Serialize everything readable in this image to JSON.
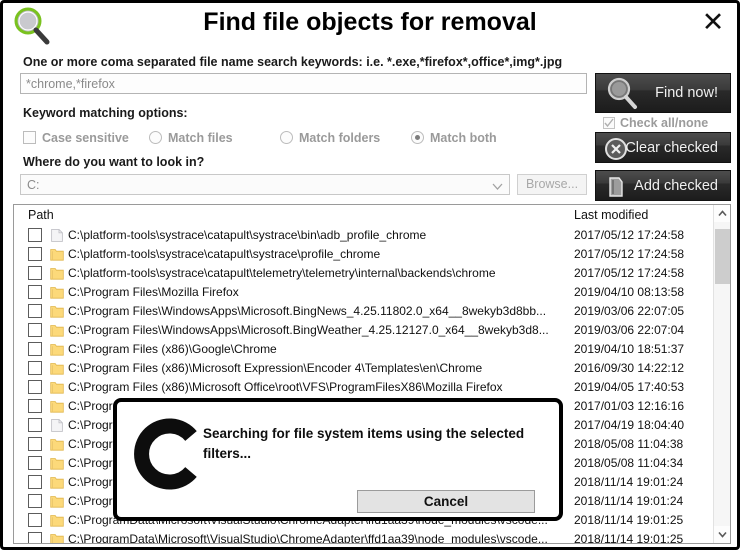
{
  "window": {
    "title": "Find file objects for removal",
    "icon": "magnifier-icon",
    "close_label": "✕"
  },
  "form": {
    "keywords_hint": "One or more coma separated file name search keywords: i.e. *.exe,*firefox*,office*,img*.jpg",
    "keywords_value": "*chrome,*firefox",
    "keywords_placeholder": "*chrome,*firefox",
    "matching_label": "Keyword matching options:",
    "options": [
      {
        "label": "Case sensitive",
        "type": "checkbox",
        "checked": false
      },
      {
        "label": "Match files",
        "type": "radio",
        "checked": false
      },
      {
        "label": "Match folders",
        "type": "radio",
        "checked": false
      },
      {
        "label": "Match both",
        "type": "radio",
        "checked": true
      }
    ],
    "where_label": "Where do you want to look in?",
    "path_value": "C:",
    "browse_label": "Browse..."
  },
  "actions": {
    "find_label": "Find now!",
    "check_all_label": "Check all/none",
    "clear_label": "Clear checked",
    "add_label": "Add checked"
  },
  "list": {
    "columns": {
      "path": "Path",
      "modified": "Last modified"
    },
    "rows": [
      {
        "icon": "file-icon",
        "path": "C:\\platform-tools\\systrace\\catapult\\systrace\\bin\\adb_profile_chrome",
        "modified": "2017/05/12 17:24:58",
        "checked": false
      },
      {
        "icon": "folder-icon",
        "path": "C:\\platform-tools\\systrace\\catapult\\systrace\\profile_chrome",
        "modified": "2017/05/12 17:24:58",
        "checked": false
      },
      {
        "icon": "folder-icon",
        "path": "C:\\platform-tools\\systrace\\catapult\\telemetry\\telemetry\\internal\\backends\\chrome",
        "modified": "2017/05/12 17:24:58",
        "checked": false
      },
      {
        "icon": "folder-icon",
        "path": "C:\\Program Files\\Mozilla Firefox",
        "modified": "2019/04/10 08:13:58",
        "checked": false
      },
      {
        "icon": "folder-icon",
        "path": "C:\\Program Files\\WindowsApps\\Microsoft.BingNews_4.25.11802.0_x64__8wekyb3d8bb...",
        "modified": "2019/03/06 22:07:05",
        "checked": false
      },
      {
        "icon": "folder-icon",
        "path": "C:\\Program Files\\WindowsApps\\Microsoft.BingWeather_4.25.12127.0_x64__8wekyb3d8...",
        "modified": "2019/03/06 22:07:04",
        "checked": false
      },
      {
        "icon": "folder-icon",
        "path": "C:\\Program Files (x86)\\Google\\Chrome",
        "modified": "2019/04/10 18:51:37",
        "checked": false
      },
      {
        "icon": "folder-icon",
        "path": "C:\\Program Files (x86)\\Microsoft Expression\\Encoder 4\\Templates\\en\\Chrome",
        "modified": "2016/09/30 14:22:12",
        "checked": false
      },
      {
        "icon": "folder-icon",
        "path": "C:\\Program Files (x86)\\Microsoft Office\\root\\VFS\\ProgramFilesX86\\Mozilla Firefox",
        "modified": "2019/04/05 17:40:53",
        "checked": false
      },
      {
        "icon": "folder-icon",
        "path": "C:\\Program...",
        "modified": "2017/01/03 12:16:16",
        "checked": false
      },
      {
        "icon": "file-icon",
        "path": "C:\\Program...",
        "modified": "2017/04/19 18:04:40",
        "checked": false
      },
      {
        "icon": "folder-icon",
        "path": "C:\\Program...",
        "modified": "2018/05/08 11:04:38",
        "checked": false
      },
      {
        "icon": "folder-icon",
        "path": "C:\\Program...",
        "modified": "2018/05/08 11:04:34",
        "checked": false
      },
      {
        "icon": "folder-icon",
        "path": "C:\\Program...",
        "modified": "2018/11/14 19:01:24",
        "checked": false
      },
      {
        "icon": "folder-icon",
        "path": "C:\\Program...",
        "modified": "2018/11/14 19:01:24",
        "checked": false
      },
      {
        "icon": "folder-icon",
        "path": "C:\\ProgramData\\Microsoft\\VisualStudio\\ChromeAdapter\\ffd1aa39\\node_modules\\vscode...",
        "modified": "2018/11/14 19:01:25",
        "checked": false
      },
      {
        "icon": "folder-icon",
        "path": "C:\\ProgramData\\Microsoft\\VisualStudio\\ChromeAdapter\\ffd1aa39\\node_modules\\vscode...",
        "modified": "2018/11/14 19:01:25",
        "checked": false
      }
    ]
  },
  "modal": {
    "message": "Searching for file system items using the selected filters...",
    "cancel_label": "Cancel",
    "spinner": "loading-spinner-icon"
  }
}
